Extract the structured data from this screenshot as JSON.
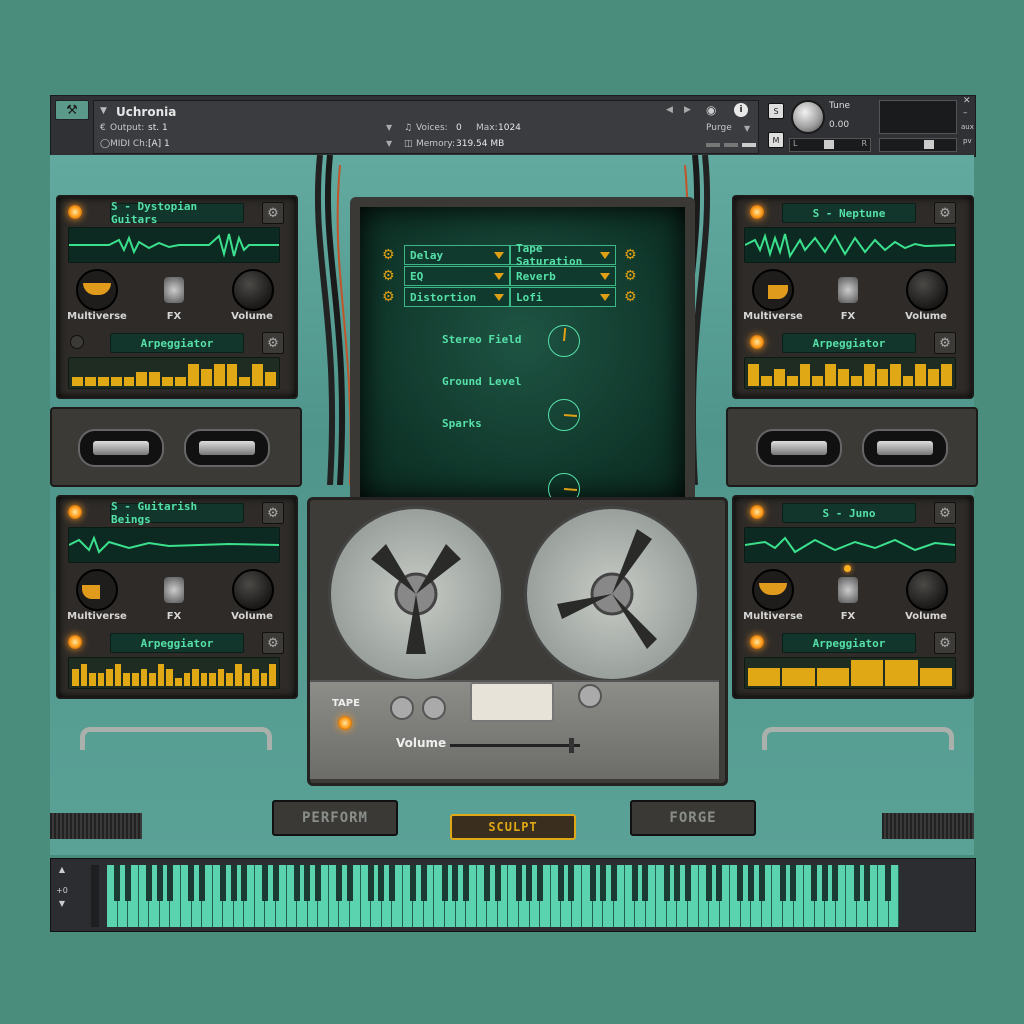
{
  "header": {
    "instrument_name": "Uchronia",
    "output_label": "Output:",
    "output_value": "st. 1",
    "midi_label": "MIDI Ch:",
    "midi_value": "[A]  1",
    "voices_label": "Voices:",
    "voices_value": "0",
    "max_label": "Max:",
    "max_value": "1024",
    "memory_label": "Memory:",
    "memory_value": "319.54 MB",
    "purge_label": "Purge",
    "solo_label": "S",
    "mute_label": "M",
    "tune_label": "Tune",
    "tune_value": "0.00",
    "aux_label": "aux",
    "pv_label": "pv",
    "meter_left": "L",
    "meter_right": "R"
  },
  "layers": [
    {
      "name": "S - Dystopian Guitars",
      "arp_label": "Arpeggiator",
      "multiverse_label": "Multiverse",
      "fx_label": "FX",
      "volume_label": "Volume",
      "arp_steps": [
        0.35,
        0.35,
        0.35,
        0.35,
        0.35,
        0.55,
        0.55,
        0.35,
        0.35,
        0.85,
        0.65,
        0.85,
        0.85,
        0.35,
        0.85,
        0.55
      ]
    },
    {
      "name": "S - Neptune",
      "arp_label": "Arpeggiator",
      "multiverse_label": "Multiverse",
      "fx_label": "FX",
      "volume_label": "Volume",
      "arp_steps": [
        0.85,
        0.4,
        0.65,
        0.4,
        0.85,
        0.4,
        0.85,
        0.65,
        0.4,
        0.85,
        0.65,
        0.85,
        0.4,
        0.85,
        0.65,
        0.85
      ]
    },
    {
      "name": "S - Guitarish Beings",
      "arp_label": "Arpeggiator",
      "multiverse_label": "Multiverse",
      "fx_label": "FX",
      "volume_label": "Volume",
      "arp_steps": [
        0.65,
        0.85,
        0.5,
        0.5,
        0.65,
        0.85,
        0.5,
        0.5,
        0.65,
        0.5,
        0.85,
        0.65,
        0.3,
        0.5,
        0.65,
        0.5,
        0.5,
        0.65,
        0.5,
        0.85,
        0.5,
        0.65,
        0.5,
        0.85
      ]
    },
    {
      "name": "S - Juno",
      "arp_label": "Arpeggiator",
      "multiverse_label": "Multiverse",
      "fx_label": "FX",
      "volume_label": "Volume",
      "arp_steps": [
        0.7,
        0.7,
        0.7,
        1.0,
        1.0,
        0.7
      ]
    }
  ],
  "effects": {
    "slots": [
      {
        "label": "Delay"
      },
      {
        "label": "Tape Saturation"
      },
      {
        "label": "EQ"
      },
      {
        "label": "Reverb"
      },
      {
        "label": "Distortion"
      },
      {
        "label": "Lofi"
      }
    ],
    "controls": [
      {
        "label": "Stereo Field",
        "value": 0.52
      },
      {
        "label": "Ground Level",
        "value": 0.85
      },
      {
        "label": "Sparks",
        "value": 0.85
      }
    ]
  },
  "deck": {
    "tape_label": "TAPE",
    "volume_label": "Volume",
    "volume_value": 0.95
  },
  "bottom": {
    "perform_label": "PERFORM",
    "sculpt_label": "SCULPT",
    "forge_label": "FORGE"
  },
  "keyboard": {
    "octave_value": "+0"
  },
  "colors": {
    "accent_green": "#55e0a8",
    "accent_amber": "#e0a815",
    "body_teal": "#5aa196"
  }
}
